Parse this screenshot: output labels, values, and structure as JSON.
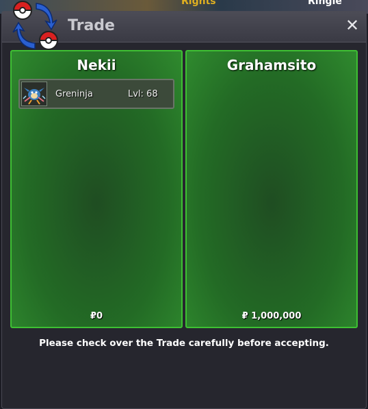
{
  "window": {
    "title": "Trade",
    "close_glyph": "✕",
    "icon": "trade-swap-icon"
  },
  "background": {
    "left_text": "Rights",
    "right_text": "Ringle"
  },
  "panels": [
    {
      "player": "Nekii",
      "items": [
        {
          "name": "Greninja",
          "level": "Lvl: 68",
          "icon": "greninja-sprite-icon"
        }
      ],
      "money": "₽0"
    },
    {
      "player": "Grahamsito",
      "items": [],
      "money": "₽ 1,000,000"
    }
  ],
  "notice": "Please check over the Trade carefully before accepting."
}
